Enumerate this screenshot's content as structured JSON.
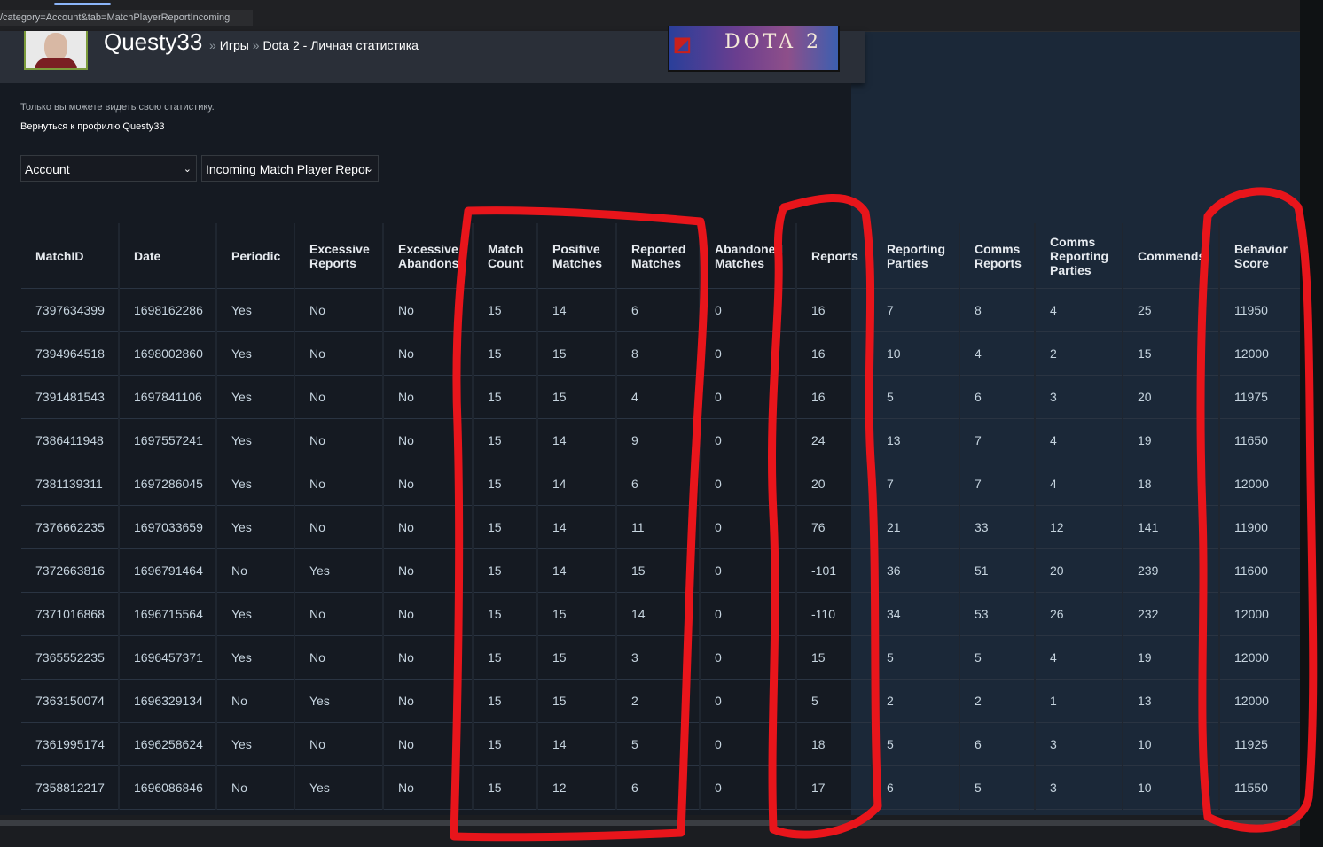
{
  "browser": {
    "url_fragment": "/category=Account&tab=MatchPlayerReportIncoming"
  },
  "header": {
    "persona_name": "Questy33",
    "breadcrumb_games": "Игры",
    "breadcrumb_page": "Dota 2 - Личная статистика",
    "breadcrumb_separator": "»",
    "game_logo_text": "DOTA 2"
  },
  "panel": {
    "privacy_notice": "Только вы можете видеть свою статистику.",
    "back_link": "Вернуться к профилю Questy33",
    "category_select_value": "Account",
    "tab_select_value": "Incoming Match Player Repor"
  },
  "table": {
    "columns": [
      "MatchID",
      "Date",
      "Periodic",
      "Excessive Reports",
      "Excessive Abandons",
      "Match Count",
      "Positive Matches",
      "Reported Matches",
      "Abandoned Matches",
      "Reports",
      "Reporting Parties",
      "Comms Reports",
      "Comms Reporting Parties",
      "Commends",
      "Behavior Score"
    ],
    "rows": [
      [
        "7397634399",
        "1698162286",
        "Yes",
        "No",
        "No",
        "15",
        "14",
        "6",
        "0",
        "16",
        "7",
        "8",
        "4",
        "25",
        "11950"
      ],
      [
        "7394964518",
        "1698002860",
        "Yes",
        "No",
        "No",
        "15",
        "15",
        "8",
        "0",
        "16",
        "10",
        "4",
        "2",
        "15",
        "12000"
      ],
      [
        "7391481543",
        "1697841106",
        "Yes",
        "No",
        "No",
        "15",
        "15",
        "4",
        "0",
        "16",
        "5",
        "6",
        "3",
        "20",
        "11975"
      ],
      [
        "7386411948",
        "1697557241",
        "Yes",
        "No",
        "No",
        "15",
        "14",
        "9",
        "0",
        "24",
        "13",
        "7",
        "4",
        "19",
        "11650"
      ],
      [
        "7381139311",
        "1697286045",
        "Yes",
        "No",
        "No",
        "15",
        "14",
        "6",
        "0",
        "20",
        "7",
        "7",
        "4",
        "18",
        "12000"
      ],
      [
        "7376662235",
        "1697033659",
        "Yes",
        "No",
        "No",
        "15",
        "14",
        "11",
        "0",
        "76",
        "21",
        "33",
        "12",
        "141",
        "11900"
      ],
      [
        "7372663816",
        "1696791464",
        "No",
        "Yes",
        "No",
        "15",
        "14",
        "15",
        "0",
        "-101",
        "36",
        "51",
        "20",
        "239",
        "11600"
      ],
      [
        "7371016868",
        "1696715564",
        "Yes",
        "No",
        "No",
        "15",
        "15",
        "14",
        "0",
        "-110",
        "34",
        "53",
        "26",
        "232",
        "12000"
      ],
      [
        "7365552235",
        "1696457371",
        "Yes",
        "No",
        "No",
        "15",
        "15",
        "3",
        "0",
        "15",
        "5",
        "5",
        "4",
        "19",
        "12000"
      ],
      [
        "7363150074",
        "1696329134",
        "No",
        "Yes",
        "No",
        "15",
        "15",
        "2",
        "0",
        "5",
        "2",
        "2",
        "1",
        "13",
        "12000"
      ],
      [
        "7361995174",
        "1696258624",
        "Yes",
        "No",
        "No",
        "15",
        "14",
        "5",
        "0",
        "18",
        "5",
        "6",
        "3",
        "10",
        "11925"
      ],
      [
        "7358812217",
        "1696086846",
        "No",
        "Yes",
        "No",
        "15",
        "12",
        "6",
        "0",
        "17",
        "6",
        "5",
        "3",
        "10",
        "11550"
      ]
    ]
  },
  "colors": {
    "annotation_red": "#e8151b",
    "page_background": "#1b2838",
    "panel_background": "#151a22"
  }
}
